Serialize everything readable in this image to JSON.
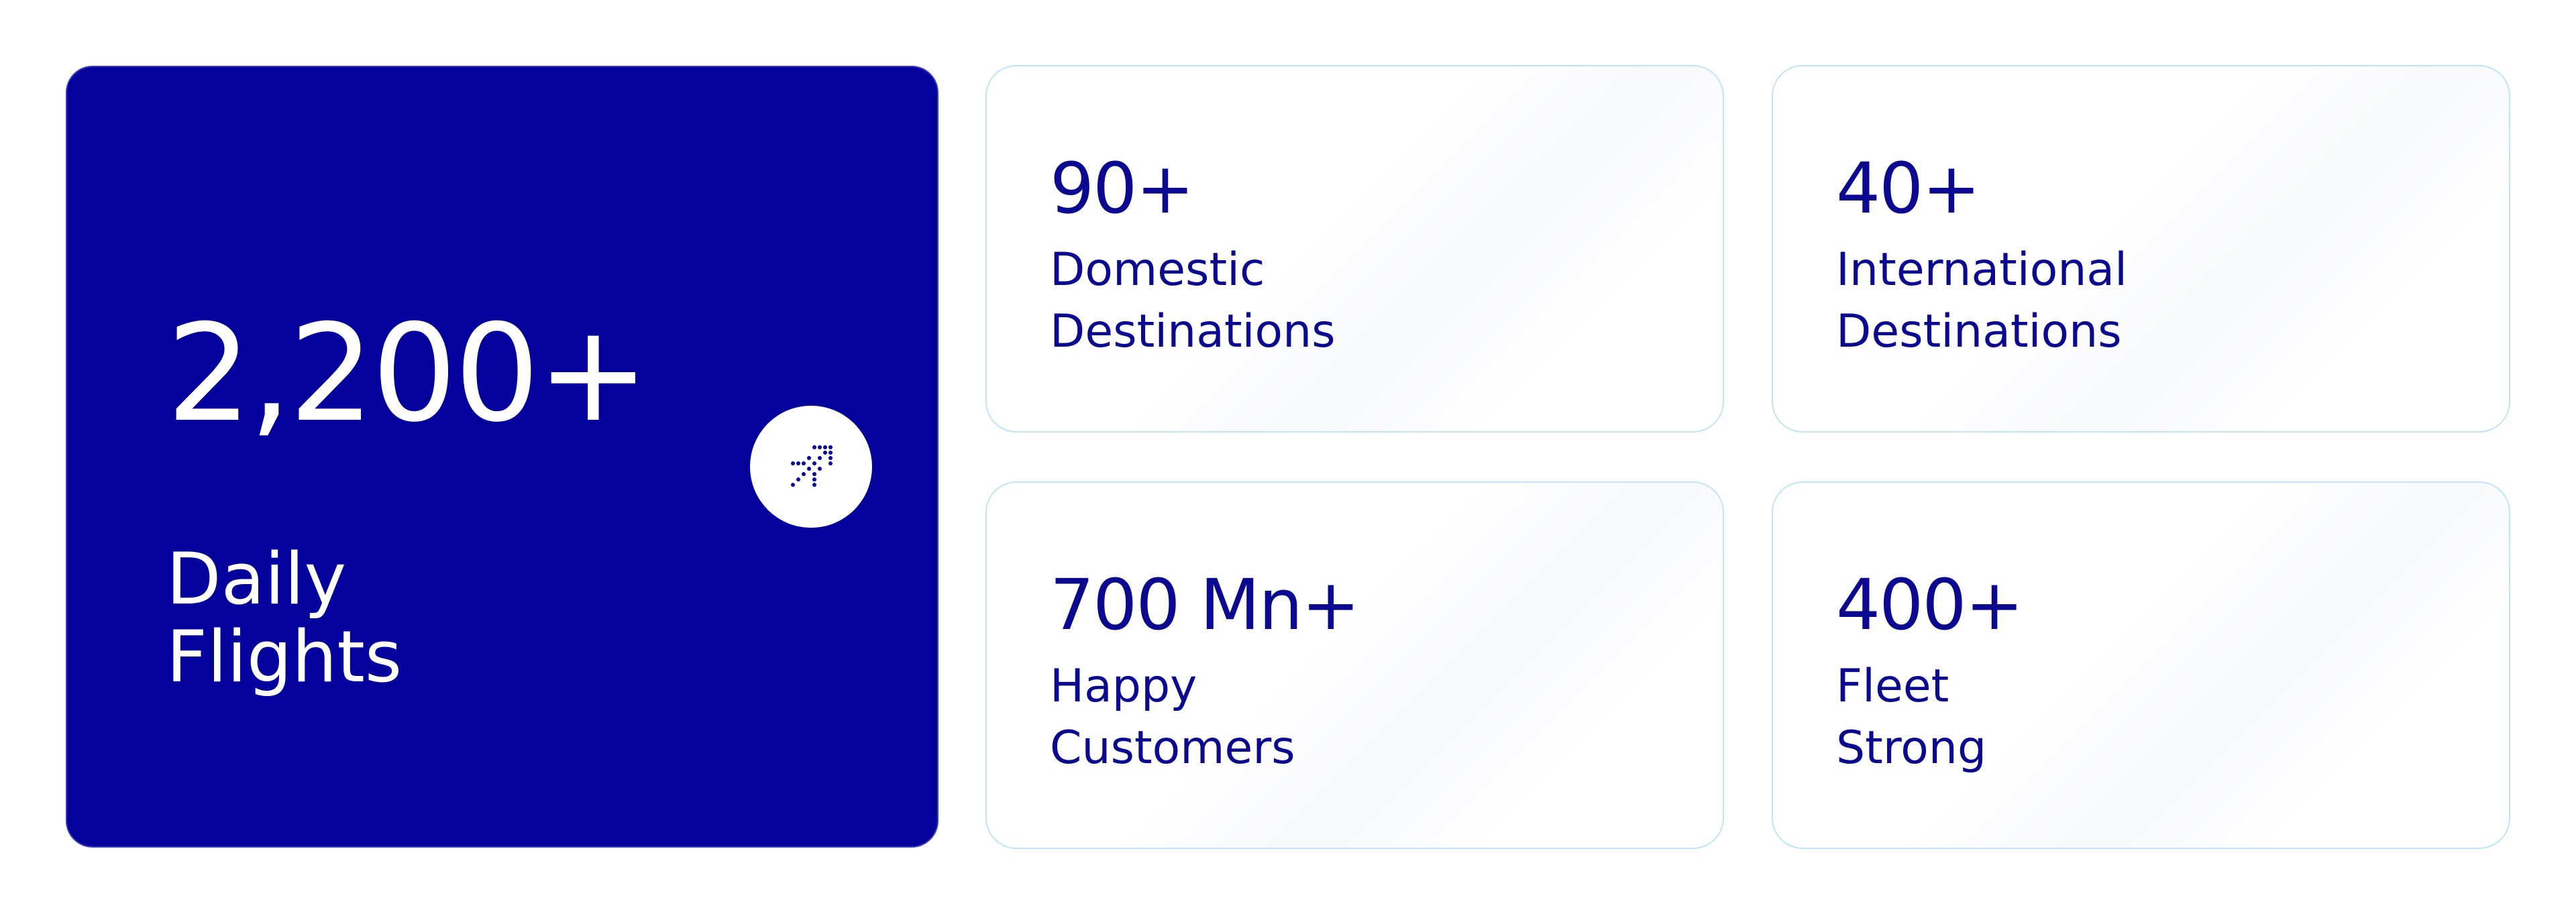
{
  "hero": {
    "value": "2,200+",
    "label_line1": "Daily",
    "label_line2": "Flights",
    "icon": "plane-takeoff-icon",
    "background_color": "#03009C"
  },
  "stats": [
    {
      "value": "90+",
      "label_line1": "Domestic",
      "label_line2": "Destinations"
    },
    {
      "value": "40+",
      "label_line1": "International",
      "label_line2": "Destinations"
    },
    {
      "value": "700 Mn+",
      "label_line1": "Happy",
      "label_line2": "Customers"
    },
    {
      "value": "400+",
      "label_line1": "Fleet",
      "label_line2": "Strong"
    }
  ],
  "colors": {
    "accent": "#0A0990",
    "card_border": "#BFE3F7"
  }
}
